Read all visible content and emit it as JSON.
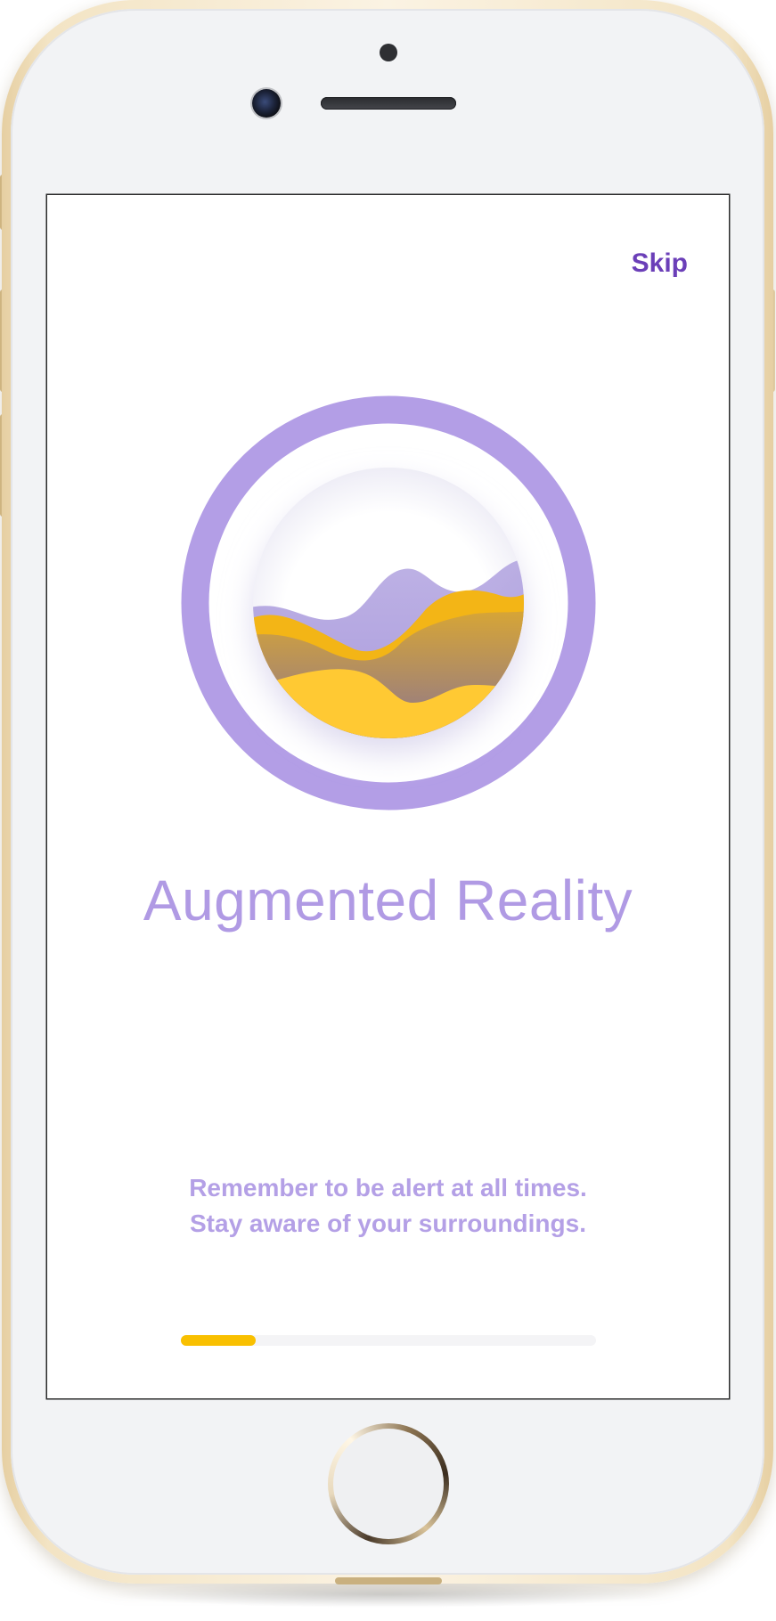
{
  "onboarding": {
    "skip_label": "Skip",
    "title": "Augmented Reality",
    "description_line1": "Remember to be alert at all times.",
    "description_line2": "Stay aware of your surroundings.",
    "progress_fraction": 0.18
  },
  "colors": {
    "accent_purple": "#b09ae4",
    "skip_purple": "#6b3fb8",
    "progress_yellow": "#f9c000",
    "ring_purple": "#b39ee6"
  },
  "icons": {
    "illustration": "landscape-waves-illustration"
  }
}
